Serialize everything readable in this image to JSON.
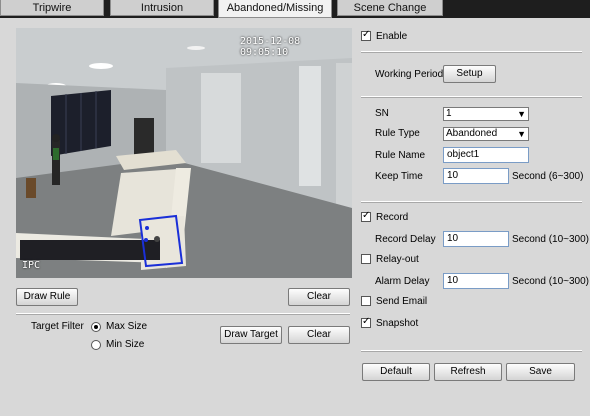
{
  "tabs": [
    {
      "label": "Tripwire"
    },
    {
      "label": "Intrusion"
    },
    {
      "label": "Abandoned/Missing"
    },
    {
      "label": "Scene Change"
    }
  ],
  "video": {
    "timestamp": "2015-12-08 09:05:10",
    "channel": "IPC"
  },
  "left_controls": {
    "draw_rule_label": "Draw Rule",
    "clear_label": "Clear",
    "target_filter_label": "Target Filter",
    "max_size_label": "Max Size",
    "min_size_label": "Min Size",
    "draw_target_label": "Draw Target",
    "clear_target_label": "Clear",
    "selected_filter": "Max Size"
  },
  "settings": {
    "enable_label": "Enable",
    "enable_checked": true,
    "working_period_label": "Working Period",
    "setup_label": "Setup",
    "sn_label": "SN",
    "sn_value": "1",
    "rule_type_label": "Rule Type",
    "rule_type_value": "Abandoned",
    "rule_name_label": "Rule Name",
    "rule_name_value": "object1",
    "keep_time_label": "Keep Time",
    "keep_time_value": "10",
    "keep_time_unit": "Second (6~300)",
    "record_label": "Record",
    "record_checked": true,
    "record_delay_label": "Record Delay",
    "record_delay_value": "10",
    "record_delay_unit": "Second (10~300)",
    "relay_out_label": "Relay-out",
    "relay_out_checked": false,
    "alarm_delay_label": "Alarm Delay",
    "alarm_delay_value": "10",
    "alarm_delay_unit": "Second (10~300)",
    "send_email_label": "Send Email",
    "send_email_checked": false,
    "snapshot_label": "Snapshot",
    "snapshot_checked": true
  },
  "footer": {
    "default_label": "Default",
    "refresh_label": "Refresh",
    "save_label": "Save"
  },
  "colors": {
    "rule_region": "#1a2fd8",
    "tab_bar": "#1e1e1e",
    "panel": "#d8d8d8"
  }
}
